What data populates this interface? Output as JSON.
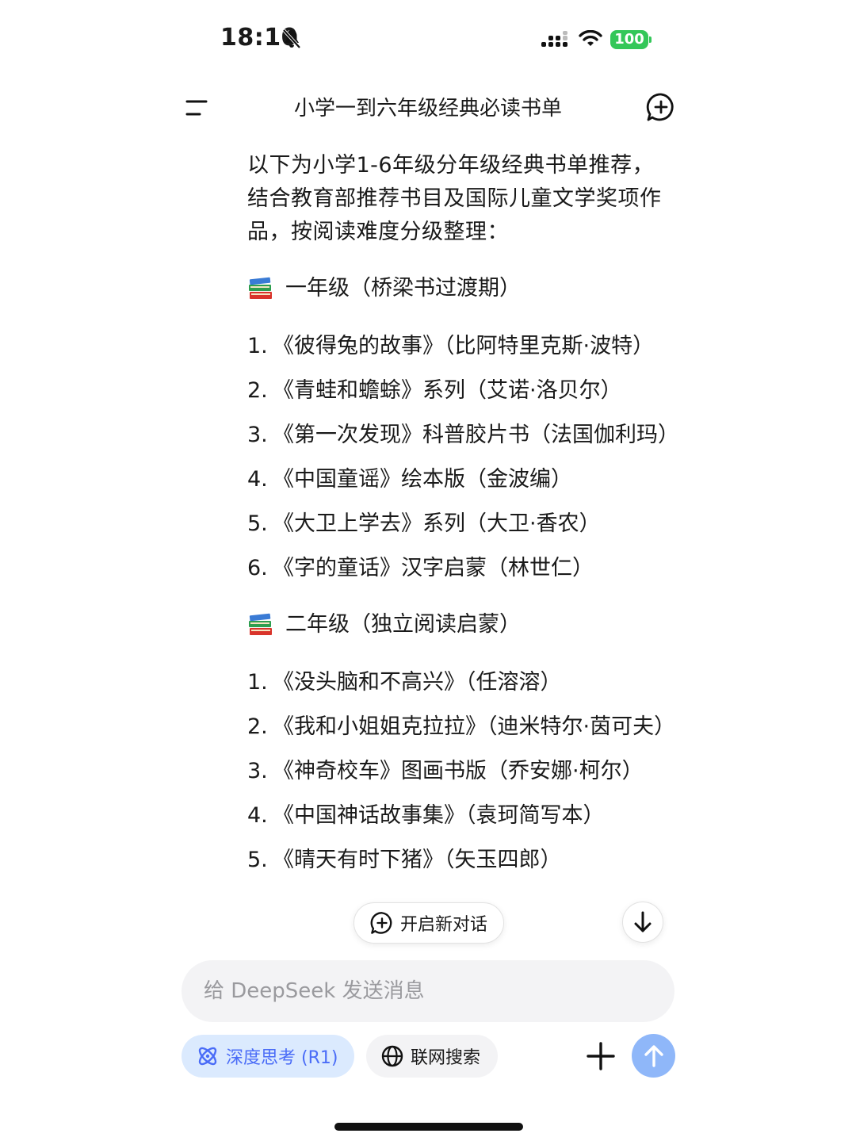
{
  "status_bar": {
    "time": "18:10",
    "battery": "100",
    "icons": [
      "bell-slash-icon",
      "signal-icon",
      "wifi-icon",
      "battery-icon"
    ],
    "battery_color": "#34c759"
  },
  "header": {
    "title": "小学一到六年级经典必读书单",
    "icons": [
      "menu-icon",
      "new-chat-icon"
    ]
  },
  "content": {
    "intro": "以下为小学1-6年级分年级经典书单推荐，结合教育部推荐书目及国际儿童文学奖项作品，按阅读难度分级整理：",
    "sections": [
      {
        "heading": "一年级（桥梁书过渡期）",
        "items": [
          {
            "num": "1.",
            "text": "《彼得兔的故事》（比阿特里克斯·波特）"
          },
          {
            "num": "2.",
            "text": "《青蛙和蟾蜍》系列（艾诺·洛贝尔）"
          },
          {
            "num": "3.",
            "text": "《第一次发现》科普胶片书（法国伽利玛）"
          },
          {
            "num": "4.",
            "text": "《中国童谣》绘本版（金波编）"
          },
          {
            "num": "5.",
            "text": "《大卫上学去》系列（大卫·香农）"
          },
          {
            "num": "6.",
            "text": "《字的童话》汉字启蒙（林世仁）"
          }
        ]
      },
      {
        "heading": "二年级（独立阅读启蒙）",
        "items": [
          {
            "num": "1.",
            "text": "《没头脑和不高兴》（任溶溶）"
          },
          {
            "num": "2.",
            "text": "《我和小姐姐克拉拉》（迪米特尔·茵可夫）"
          },
          {
            "num": "3.",
            "text": "《神奇校车》图画书版（乔安娜·柯尔）"
          },
          {
            "num": "4.",
            "text": "《中国神话故事集》（袁珂简写本）"
          },
          {
            "num": "5.",
            "text": "《晴天有时下猪》（矢玉四郎）"
          }
        ]
      }
    ]
  },
  "floating": {
    "new_conversation": "开启新对话"
  },
  "composer": {
    "placeholder": "给 DeepSeek 发送消息",
    "deep_think": "深度思考 (R1)",
    "web_search": "联网搜索",
    "accent_color": "#4a6cf7",
    "send_color": "#8fb7f9"
  }
}
